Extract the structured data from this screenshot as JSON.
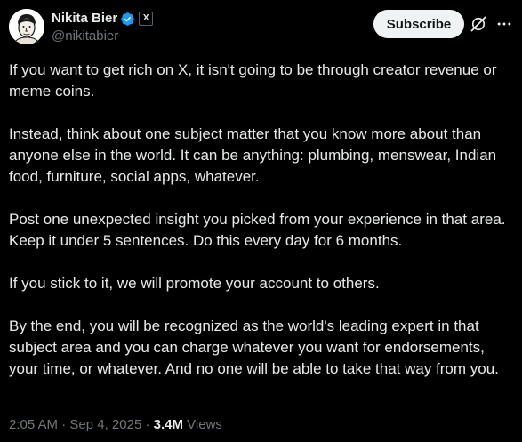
{
  "author": {
    "display_name": "Nikita Bier",
    "handle": "@nikitabier",
    "affiliate_badge": "X",
    "avatar_icon": "avatar-illustration"
  },
  "actions": {
    "subscribe_label": "Subscribe",
    "grok_icon": "grok-icon",
    "more_icon": "more-icon"
  },
  "tweet": {
    "paragraphs": [
      "If you want to get rich on X, it isn't going to be through creator revenue or meme coins.",
      "Instead, think about one subject matter that you know more about than anyone else in the world. It can be anything: plumbing, menswear, Indian food, furniture, social apps, whatever.",
      "Post one unexpected insight you picked from your experience in that area. Keep it under 5 sentences. Do this every day for 6 months.",
      "If you stick to it, we will promote your account to others.",
      "By the end, you will be recognized as the world's leading expert in that subject area and you can charge whatever you want for endorsements, your time, or whatever. And no one will be able to take that way from you."
    ]
  },
  "meta": {
    "time": "2:05 AM",
    "separator": "·",
    "date": "Sep 4, 2025",
    "views_count": "3.4M",
    "views_label": "Views"
  },
  "colors": {
    "background": "#000000",
    "text": "#e7e9ea",
    "muted": "#71767b",
    "verified": "#1d9bf0",
    "button_bg": "#eff3f4"
  }
}
